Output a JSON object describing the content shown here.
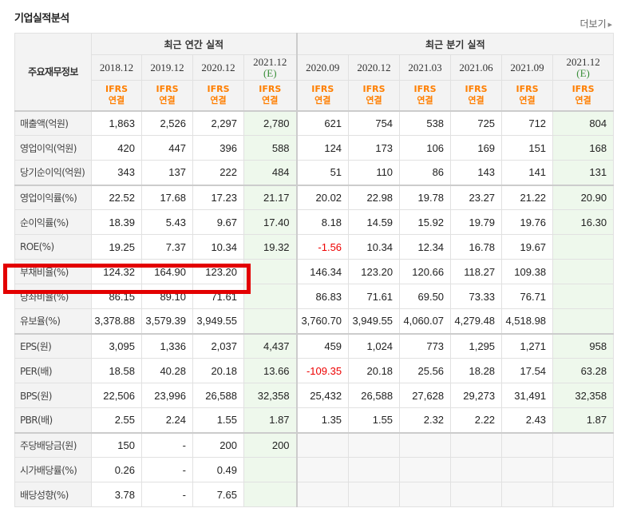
{
  "section_title": "기업실적분석",
  "more_link": "더보기",
  "header": {
    "corner_label": "주요재무정보",
    "annual_group": "최근 연간 실적",
    "quarter_group": "최근 분기 실적",
    "periods": [
      {
        "label": "2018.12",
        "est": ""
      },
      {
        "label": "2019.12",
        "est": ""
      },
      {
        "label": "2020.12",
        "est": ""
      },
      {
        "label": "2021.12",
        "est": "(E)"
      },
      {
        "label": "2020.09",
        "est": ""
      },
      {
        "label": "2020.12",
        "est": ""
      },
      {
        "label": "2021.03",
        "est": ""
      },
      {
        "label": "2021.06",
        "est": ""
      },
      {
        "label": "2021.09",
        "est": ""
      },
      {
        "label": "2021.12",
        "est": "(E)"
      }
    ],
    "ifrs_line1": "IFRS",
    "ifrs_line2": "연결"
  },
  "rows": [
    {
      "label": "매출액(억원)",
      "values": [
        "1,863",
        "2,526",
        "2,297",
        "2,780",
        "621",
        "754",
        "538",
        "725",
        "712",
        "804"
      ]
    },
    {
      "label": "영업이익(억원)",
      "values": [
        "420",
        "447",
        "396",
        "588",
        "124",
        "173",
        "106",
        "169",
        "151",
        "168"
      ]
    },
    {
      "label": "당기순이익(억원)",
      "values": [
        "343",
        "137",
        "222",
        "484",
        "51",
        "110",
        "86",
        "143",
        "141",
        "131"
      ]
    },
    {
      "label": "영업이익률(%)",
      "values": [
        "22.52",
        "17.68",
        "17.23",
        "21.17",
        "20.02",
        "22.98",
        "19.78",
        "23.27",
        "21.22",
        "20.90"
      ]
    },
    {
      "label": "순이익률(%)",
      "values": [
        "18.39",
        "5.43",
        "9.67",
        "17.40",
        "8.18",
        "14.59",
        "15.92",
        "19.79",
        "19.76",
        "16.30"
      ]
    },
    {
      "label": "ROE(%)",
      "values": [
        "19.25",
        "7.37",
        "10.34",
        "19.32",
        "-1.56",
        "10.34",
        "12.34",
        "16.78",
        "19.67",
        ""
      ]
    },
    {
      "label": "부채비율(%)",
      "values": [
        "124.32",
        "164.90",
        "123.20",
        "",
        "146.34",
        "123.20",
        "120.66",
        "118.27",
        "109.38",
        ""
      ]
    },
    {
      "label": "당좌비율(%)",
      "values": [
        "86.15",
        "89.10",
        "71.61",
        "",
        "86.83",
        "71.61",
        "69.50",
        "73.33",
        "76.71",
        ""
      ]
    },
    {
      "label": "유보율(%)",
      "values": [
        "3,378.88",
        "3,579.39",
        "3,949.55",
        "",
        "3,760.70",
        "3,949.55",
        "4,060.07",
        "4,279.48",
        "4,518.98",
        ""
      ]
    },
    {
      "label": "EPS(원)",
      "values": [
        "3,095",
        "1,336",
        "2,037",
        "4,437",
        "459",
        "1,024",
        "773",
        "1,295",
        "1,271",
        "958"
      ]
    },
    {
      "label": "PER(배)",
      "values": [
        "18.58",
        "40.28",
        "20.18",
        "13.66",
        "-109.35",
        "20.18",
        "25.56",
        "18.28",
        "17.54",
        "63.28"
      ]
    },
    {
      "label": "BPS(원)",
      "values": [
        "22,506",
        "23,996",
        "26,588",
        "32,358",
        "25,432",
        "26,588",
        "27,628",
        "29,273",
        "31,491",
        "32,358"
      ]
    },
    {
      "label": "PBR(배)",
      "values": [
        "2.55",
        "2.24",
        "1.55",
        "1.87",
        "1.35",
        "1.55",
        "2.32",
        "2.22",
        "2.43",
        "1.87"
      ]
    },
    {
      "label": "주당배당금(원)",
      "values": [
        "150",
        "-",
        "200",
        "200",
        "",
        "",
        "",
        "",
        "",
        ""
      ]
    },
    {
      "label": "시가배당률(%)",
      "values": [
        "0.26",
        "-",
        "0.49",
        "",
        "",
        "",
        "",
        "",
        "",
        ""
      ]
    },
    {
      "label": "배당성향(%)",
      "values": [
        "3.78",
        "-",
        "7.65",
        "",
        "",
        "",
        "",
        "",
        "",
        ""
      ]
    }
  ],
  "colors": {
    "negative": "#e00000",
    "ifrs": "#ff7f00",
    "estimate_bg": "#eef8ec",
    "highlight": "#e30000"
  }
}
